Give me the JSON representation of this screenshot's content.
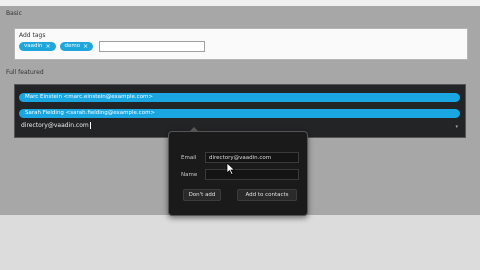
{
  "sections": {
    "basic": {
      "title": "Basic",
      "label": "Add tags",
      "tags": [
        {
          "text": "vaadin"
        },
        {
          "text": "demo"
        }
      ],
      "remove_glyph": "×",
      "input_value": ""
    },
    "full": {
      "title": "Full featured",
      "contacts": [
        {
          "text": "Marc Einstein <marc.einstein@example.com>"
        },
        {
          "text": "Sarah Fielding <sarah.fielding@example.com>"
        }
      ],
      "input_value": "directory@vaadin.com",
      "dropdown_glyph": "▾"
    }
  },
  "popup": {
    "email_label": "Email",
    "email_value": "directory@vaadin.com",
    "name_label": "Name",
    "name_value": "",
    "dont_add_label": "Don't add",
    "add_label": "Add to contacts"
  },
  "colors": {
    "accent": "#19a6e1",
    "dark_panel": "#232426",
    "popup_bg": "#1a1a1b"
  }
}
